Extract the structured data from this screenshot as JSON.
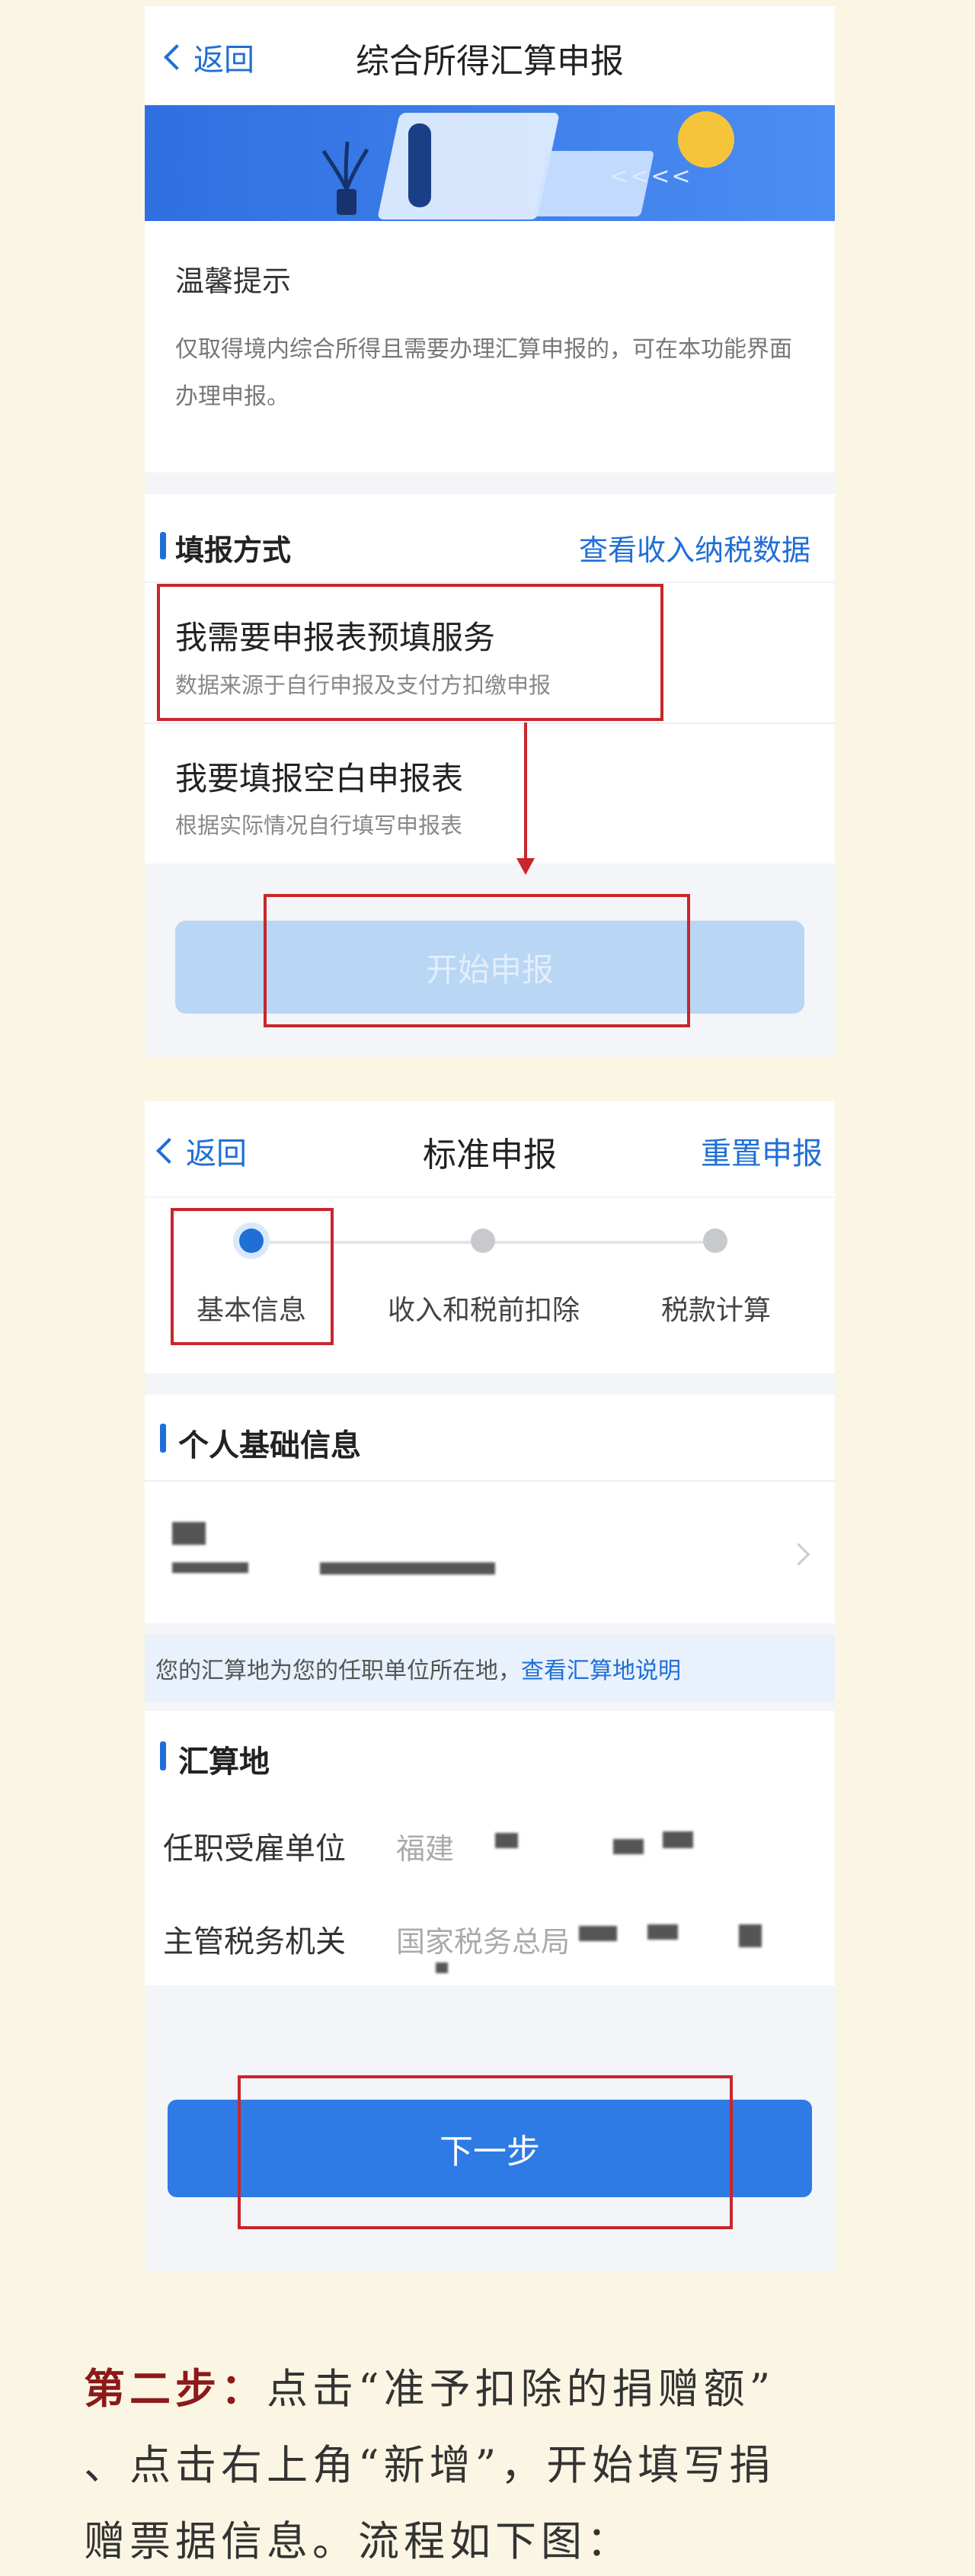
{
  "screen1": {
    "nav": {
      "back_label": "返回",
      "title": "综合所得汇算申报"
    },
    "banner": {
      "arrows": "<<<<"
    },
    "tips": {
      "title": "温馨提示",
      "text": "仅取得境内综合所得且需要办理汇算申报的，可在本功能界面办理申报。"
    },
    "fill_method": {
      "title": "填报方式",
      "link": "查看收入纳税数据",
      "options": [
        {
          "title": "我需要申报表预填服务",
          "subtitle": "数据来源于自行申报及支付方扣缴申报"
        },
        {
          "title": "我要填报空白申报表",
          "subtitle": "根据实际情况自行填写申报表"
        }
      ]
    },
    "start_button": "开始申报"
  },
  "screen2": {
    "nav": {
      "back_label": "返回",
      "title": "标准申报",
      "reset": "重置申报"
    },
    "steps": [
      {
        "label": "基本信息",
        "active": true
      },
      {
        "label": "收入和税前扣除",
        "active": false
      },
      {
        "label": "税款计算",
        "active": false
      }
    ],
    "personal": {
      "title": "个人基础信息"
    },
    "notice": {
      "text": "您的汇算地为您的任职单位所在地，",
      "link": "查看汇算地说明"
    },
    "location": {
      "title": "汇算地",
      "fields": [
        {
          "label": "任职受雇单位",
          "value": "福建"
        },
        {
          "label": "主管税务机关",
          "value": "国家税务总局"
        }
      ]
    },
    "next_button": "下一步"
  },
  "instruction": {
    "step_label": "第二步：",
    "line1": "点击“准予扣除的捐赠额”",
    "line2": "、点击右上角“新增”，开始填写捐",
    "line3": "赠票据信息。流程如下图："
  },
  "colors": {
    "accent": "#1f6fd6",
    "highlight_box": "#c8262c",
    "page_background": "#fbf6e4",
    "step_label": "#8b1a1a"
  }
}
